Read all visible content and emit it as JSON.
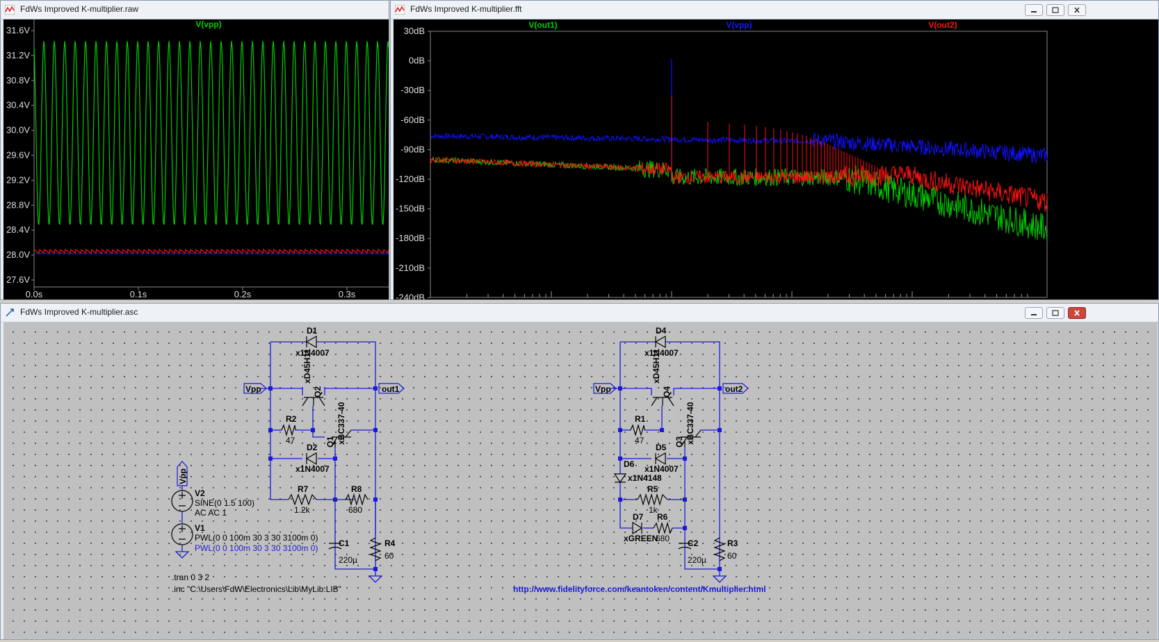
{
  "windows": {
    "transient": {
      "title": "FdWs Improved K-multiplier.raw",
      "trace_label": "V(vpp)",
      "y_ticks": [
        "31.6V",
        "31.2V",
        "30.8V",
        "30.4V",
        "30.0V",
        "29.6V",
        "29.2V",
        "28.8V",
        "28.4V",
        "28.0V",
        "27.6V"
      ],
      "x_ticks": [
        "0.0s",
        "0.1s",
        "0.2s",
        "0.3s"
      ]
    },
    "fft": {
      "title": "FdWs Improved K-multiplier.fft",
      "trace_labels": [
        "V(out1)",
        "V(vpp)",
        "V(out2)"
      ],
      "y_ticks": [
        "30dB",
        "0dB",
        "-30dB",
        "-60dB",
        "-90dB",
        "-120dB",
        "-150dB",
        "-180dB",
        "-210dB",
        "-240dB"
      ]
    },
    "schematic": {
      "title": "FdWs Improved K-multiplier.asc",
      "left": {
        "D1": "D1",
        "D1_model": "x1N4007",
        "Q2": "Q2",
        "Q2_model": "xD45H11",
        "Q1": "Q1",
        "Q1_model": "xBC337-40",
        "R2": "R2",
        "R2_val": "47",
        "D2": "D2",
        "D2_model": "x1N4007",
        "R7": "R7",
        "R7_val": "1.2k",
        "R8": "R8",
        "R8_val": "680",
        "C1": "C1",
        "C1_val": "220µ",
        "R4": "R4",
        "R4_val": "60",
        "vpp_flag": "Vpp",
        "out_flag": "out1"
      },
      "right": {
        "D4": "D4",
        "D4_model": "x1N4007",
        "Q4": "Q4",
        "Q4_model": "xD45H11",
        "Q3": "Q3",
        "Q3_model": "xBC337-40",
        "R1": "R1",
        "R1_val": "47",
        "D5": "D5",
        "D5_model": "x1N4007",
        "D6": "D6",
        "D6_model": "x1N4148",
        "R5": "R5",
        "R5_val": "1k",
        "D7": "D7",
        "D7_model": "xGREEN",
        "R6": "R6",
        "R6_val": "680",
        "C2": "C2",
        "C2_val": "220µ",
        "R3": "R3",
        "R3_val": "60",
        "vpp_flag": "Vpp",
        "out_flag": "out2"
      },
      "sources": {
        "vpp_flag": "Vpp",
        "V2": "V2",
        "V2_value": "SINE(0 1.5 100)",
        "V2_ac": "AC AC 1",
        "V1": "V1",
        "V1_value": "PWL(0 0 100m 30 3 30 3100m 0)",
        "V1_value_blue": "PWL(0 0 100m 30 3 30 3100m 0)"
      },
      "directives": {
        "tran": ".tran 0 3 2",
        "inc": ".inc \"C:\\Users\\FdW\\Electronics\\Lib\\MyLib.LIB\""
      },
      "url": "http://www.fidelityforce.com/keantoken/content/Kmultiplier.html"
    }
  },
  "colors": {
    "green": "#00d000",
    "blue": "#1010ff",
    "red": "#ff1010",
    "wire": "#1a1ad8",
    "plot_bg": "#000000",
    "sheet_bg": "#c0c0c0"
  }
}
